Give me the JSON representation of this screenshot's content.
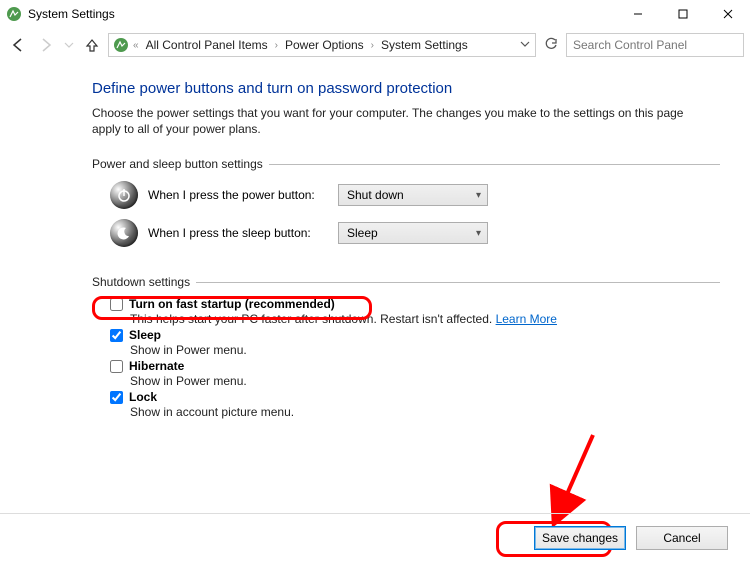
{
  "window": {
    "title": "System Settings"
  },
  "breadcrumb": {
    "items": [
      "All Control Panel Items",
      "Power Options",
      "System Settings"
    ]
  },
  "search": {
    "placeholder": "Search Control Panel"
  },
  "page": {
    "heading": "Define power buttons and turn on password protection",
    "desc": "Choose the power settings that you want for your computer. The changes you make to the settings on this page apply to all of your power plans."
  },
  "sections": {
    "buttons_legend": "Power and sleep button settings",
    "shutdown_legend": "Shutdown settings"
  },
  "power_rows": {
    "power_label": "When I press the power button:",
    "power_value": "Shut down",
    "sleep_label": "When I press the sleep button:",
    "sleep_value": "Sleep"
  },
  "shutdown": {
    "fast_startup": {
      "label": "Turn on fast startup (recommended)",
      "sub": "This helps start your PC faster after shutdown. Restart isn't affected. ",
      "link": "Learn More",
      "checked": false
    },
    "sleep": {
      "label": "Sleep",
      "sub": "Show in Power menu.",
      "checked": true
    },
    "hibernate": {
      "label": "Hibernate",
      "sub": "Show in Power menu.",
      "checked": false
    },
    "lock": {
      "label": "Lock",
      "sub": "Show in account picture menu.",
      "checked": true
    }
  },
  "footer": {
    "save": "Save changes",
    "cancel": "Cancel"
  }
}
